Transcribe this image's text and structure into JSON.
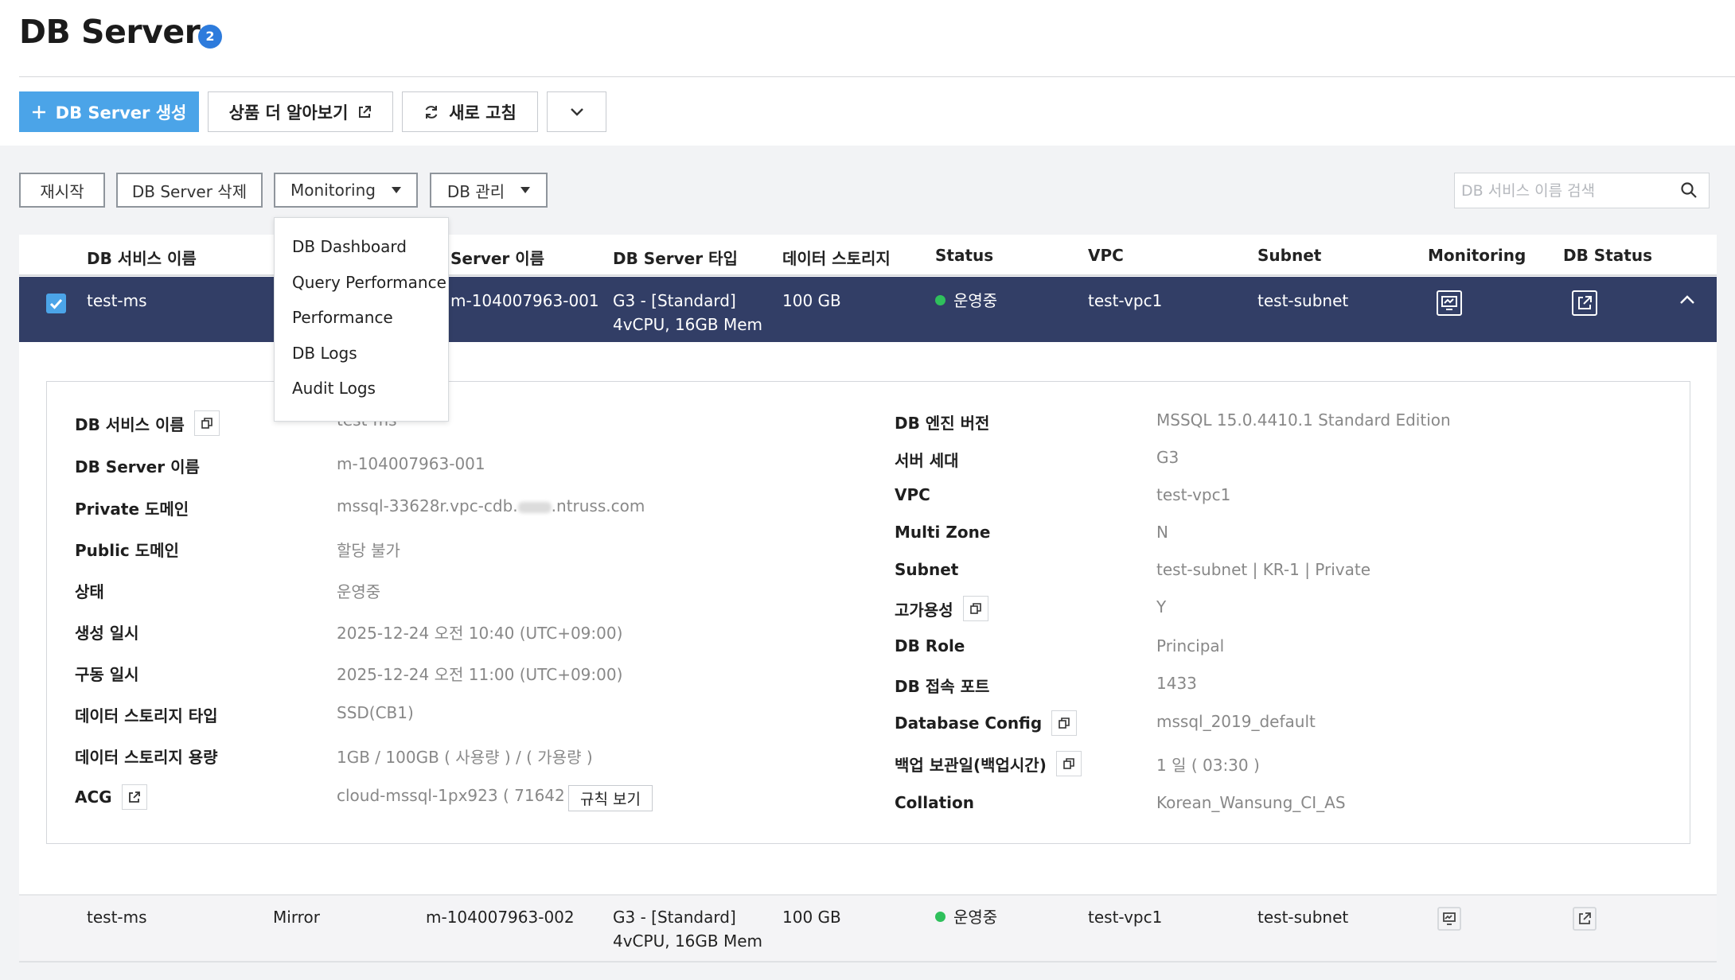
{
  "header": {
    "title": "DB Server",
    "count": "2",
    "create_label": "DB Server 생성",
    "learn_more_label": "상품 더 알아보기",
    "refresh_label": "새로 고침"
  },
  "actions": {
    "restart": "재시작",
    "delete": "DB Server 삭제",
    "monitoring": "Monitoring",
    "db_manage": "DB 관리"
  },
  "search": {
    "placeholder": "DB 서비스 이름 검색"
  },
  "monitoring_menu": {
    "items": [
      "DB Dashboard",
      "Query Performance",
      "Performance",
      "DB Logs",
      "Audit Logs"
    ]
  },
  "table": {
    "columns": {
      "service_name": "DB 서비스 이름",
      "server_name": "Server 이름",
      "server_type": "DB Server 타입",
      "storage": "데이터 스토리지",
      "status": "Status",
      "vpc": "VPC",
      "subnet": "Subnet",
      "monitoring": "Monitoring",
      "db_status": "DB Status"
    },
    "rows": [
      {
        "service_name": "test-ms",
        "role": "",
        "server_name": "m-104007963-001",
        "server_type_line1": "G3 - [Standard]",
        "server_type_line2": "4vCPU, 16GB Mem",
        "storage": "100 GB",
        "status": "운영중",
        "vpc": "test-vpc1",
        "subnet": "test-subnet"
      },
      {
        "service_name": "test-ms",
        "role": "Mirror",
        "server_name": "m-104007963-002",
        "server_type_line1": "G3 - [Standard]",
        "server_type_line2": "4vCPU, 16GB Mem",
        "storage": "100 GB",
        "status": "운영중",
        "vpc": "test-vpc1",
        "subnet": "test-subnet"
      }
    ]
  },
  "detail": {
    "left": [
      {
        "label": "DB 서비스 이름",
        "value": "test-ms"
      },
      {
        "label": "DB Server 이름",
        "value": "m-104007963-001"
      },
      {
        "label": "Private 도메인",
        "value_prefix": "mssql-33628r.vpc-cdb.",
        "value_suffix": ".ntruss.com"
      },
      {
        "label": "Public 도메인",
        "value": "할당 불가"
      },
      {
        "label": "상태",
        "value": "운영중"
      },
      {
        "label": "생성 일시",
        "value": "2025-12-24 오전 10:40 (UTC+09:00)"
      },
      {
        "label": "구동 일시",
        "value": "2025-12-24 오전 11:00 (UTC+09:00)"
      },
      {
        "label": "데이터 스토리지 타입",
        "value": "SSD(CB1)"
      },
      {
        "label": "데이터 스토리지 용량",
        "value": "1GB / 100GB ( 사용량 ) / ( 가용량 )"
      },
      {
        "label": "ACG",
        "value": "cloud-mssql-1px923 ( 71642 )",
        "button": "규칙 보기"
      }
    ],
    "right": [
      {
        "label": "DB 엔진 버전",
        "value": "MSSQL 15.0.4410.1 Standard Edition"
      },
      {
        "label": "서버 세대",
        "value": "G3"
      },
      {
        "label": "VPC",
        "value": "test-vpc1"
      },
      {
        "label": "Multi Zone",
        "value": "N"
      },
      {
        "label": "Subnet",
        "value": "test-subnet | KR-1 | Private"
      },
      {
        "label": "고가용성",
        "value": "Y"
      },
      {
        "label": "DB Role",
        "value": "Principal"
      },
      {
        "label": "DB 접속 포트",
        "value": "1433"
      },
      {
        "label": "Database Config",
        "value": "mssql_2019_default"
      },
      {
        "label": "백업 보관일(백업시간)",
        "value": "1 일 ( 03:30 )"
      },
      {
        "label": "Collation",
        "value": "Korean_Wansung_CI_AS"
      }
    ]
  },
  "colors": {
    "primary": "#4ba4e8",
    "selected_row": "#323e66",
    "status_ok": "#2fc05c",
    "badge": "#2d7bdc"
  }
}
